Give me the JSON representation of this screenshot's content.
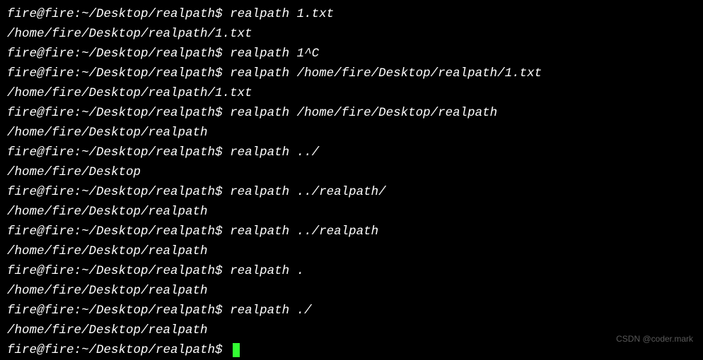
{
  "terminal": {
    "prompt": "fire@fire:~/Desktop/realpath$",
    "lines": [
      {
        "type": "cmd",
        "command": "realpath 1.txt"
      },
      {
        "type": "out",
        "text": "/home/fire/Desktop/realpath/1.txt"
      },
      {
        "type": "cmd",
        "command": "realpath 1^C"
      },
      {
        "type": "cmd",
        "command": "realpath /home/fire/Desktop/realpath/1.txt"
      },
      {
        "type": "out",
        "text": "/home/fire/Desktop/realpath/1.txt"
      },
      {
        "type": "cmd",
        "command": "realpath /home/fire/Desktop/realpath"
      },
      {
        "type": "out",
        "text": "/home/fire/Desktop/realpath"
      },
      {
        "type": "cmd",
        "command": "realpath ../"
      },
      {
        "type": "out",
        "text": "/home/fire/Desktop"
      },
      {
        "type": "cmd",
        "command": "realpath ../realpath/"
      },
      {
        "type": "out",
        "text": "/home/fire/Desktop/realpath"
      },
      {
        "type": "cmd",
        "command": "realpath ../realpath"
      },
      {
        "type": "out",
        "text": "/home/fire/Desktop/realpath"
      },
      {
        "type": "cmd",
        "command": "realpath ."
      },
      {
        "type": "out",
        "text": "/home/fire/Desktop/realpath"
      },
      {
        "type": "cmd",
        "command": "realpath ./"
      },
      {
        "type": "out",
        "text": "/home/fire/Desktop/realpath"
      },
      {
        "type": "prompt-cursor"
      }
    ]
  },
  "watermark": "CSDN @coder.mark"
}
